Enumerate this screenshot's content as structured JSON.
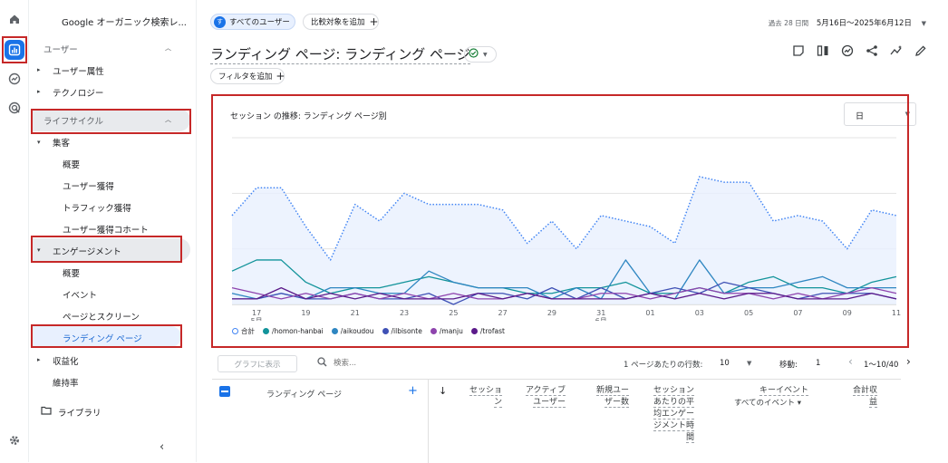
{
  "rail": {
    "icons": [
      "home-icon",
      "reports-icon",
      "explore-icon",
      "advertising-icon",
      "settings-icon"
    ]
  },
  "sidebar": {
    "property_title": "Google オーガニック検索レ...",
    "user_section": "ユーザー",
    "user_attributes": "ユーザー属性",
    "technology": "テクノロジー",
    "lifecycle": "ライフサイクル",
    "acquisition": "集客",
    "acq_overview": "概要",
    "user_acquisition": "ユーザー獲得",
    "traffic_acquisition": "トラフィック獲得",
    "user_acq_cohort": "ユーザー獲得コホート",
    "engagement": "エンゲージメント",
    "eng_overview": "概要",
    "events": "イベント",
    "pages_screens": "ページとスクリーン",
    "landing_page": "ランディング ページ",
    "monetization": "収益化",
    "retention": "維持率",
    "library": "ライブラリ"
  },
  "header": {
    "segment_chip": "すべてのユーザー",
    "segment_badge": "す",
    "compare_chip": "比較対象を追加",
    "date_prefix": "過去 28 日間",
    "date_range": "5月16日〜2025年6月12日",
    "title": "ランディング ページ: ランディング ページ",
    "filter_chip": "フィルタを追加"
  },
  "chart_data": {
    "type": "line",
    "title": "セッション の推移: ランディング ページ別",
    "granularity": "日",
    "x": [
      "17 5月",
      "18",
      "19",
      "20",
      "21",
      "22",
      "23",
      "24",
      "25",
      "26",
      "27",
      "28",
      "29",
      "30",
      "31",
      "01 6月",
      "02",
      "03",
      "04",
      "05",
      "06",
      "07",
      "08",
      "09",
      "10",
      "11",
      "12"
    ],
    "x_tick_labels": [
      "17",
      "19",
      "21",
      "23",
      "25",
      "27",
      "29",
      "31",
      "01",
      "03",
      "05",
      "07",
      "09",
      "11"
    ],
    "x_month_labels": [
      "5月",
      "6月"
    ],
    "y_ticks": [
      0,
      10,
      20,
      30
    ],
    "ylim": [
      0,
      30
    ],
    "series": [
      {
        "name": "合計",
        "color": "#4285f4",
        "dotted": true,
        "area": true,
        "values": [
          16,
          21,
          21,
          14,
          8,
          18,
          15,
          20,
          18,
          18,
          18,
          17,
          11,
          15,
          10,
          16,
          15,
          14,
          11,
          23,
          22,
          22,
          15,
          16,
          15,
          10,
          17,
          16
        ]
      },
      {
        "name": "/homon-hanbai",
        "color": "#12939a",
        "values": [
          6,
          8,
          8,
          4,
          2,
          3,
          3,
          4,
          5,
          4,
          3,
          3,
          2,
          2,
          3,
          3,
          4,
          2,
          2,
          3,
          2,
          4,
          5,
          3,
          3,
          2,
          4,
          5
        ]
      },
      {
        "name": "/aikoudou",
        "color": "#2e86c1",
        "values": [
          2,
          1,
          2,
          1,
          3,
          3,
          2,
          2,
          6,
          4,
          3,
          3,
          3,
          1,
          3,
          1,
          8,
          2,
          1,
          8,
          2,
          3,
          3,
          4,
          5,
          3,
          3,
          3
        ]
      },
      {
        "name": "/ilbisonte",
        "color": "#3f51b5",
        "values": [
          1,
          1,
          2,
          1,
          1,
          2,
          1,
          1,
          2,
          0,
          2,
          2,
          1,
          3,
          1,
          3,
          1,
          2,
          3,
          2,
          4,
          3,
          2,
          1,
          2,
          2,
          2,
          1
        ]
      },
      {
        "name": "/manju",
        "color": "#8e44ad",
        "values": [
          3,
          2,
          1,
          2,
          1,
          2,
          1,
          2,
          1,
          2,
          1,
          1,
          2,
          1,
          1,
          2,
          2,
          1,
          2,
          3,
          2,
          2,
          1,
          2,
          1,
          2,
          3,
          2
        ]
      },
      {
        "name": "/trofast",
        "color": "#5b1a8a",
        "values": [
          1,
          1,
          3,
          1,
          2,
          1,
          2,
          1,
          1,
          1,
          2,
          1,
          2,
          1,
          1,
          1,
          1,
          2,
          1,
          2,
          1,
          2,
          2,
          1,
          1,
          1,
          2,
          1
        ]
      }
    ]
  },
  "table": {
    "show_in_graph": "グラフに表示",
    "search_placeholder": "検索...",
    "rows_per_page_label": "1 ページあたりの行数:",
    "rows_per_page": "10",
    "move_label": "移動:",
    "move_value": "1",
    "page_range": "1〜10/40",
    "dimension_header": "ランディング ページ",
    "metric_cols": [
      {
        "label": "セッショ\nン"
      },
      {
        "label": "アクティブ\nユーザー"
      },
      {
        "label": "新規ユー\nザー数"
      },
      {
        "label": "セッション\nあたりの平\n均エンゲー\nジメント時\n間"
      },
      {
        "label": "キーイベント",
        "sub": "すべてのイベント"
      },
      {
        "label": "合計収\n益"
      }
    ]
  }
}
